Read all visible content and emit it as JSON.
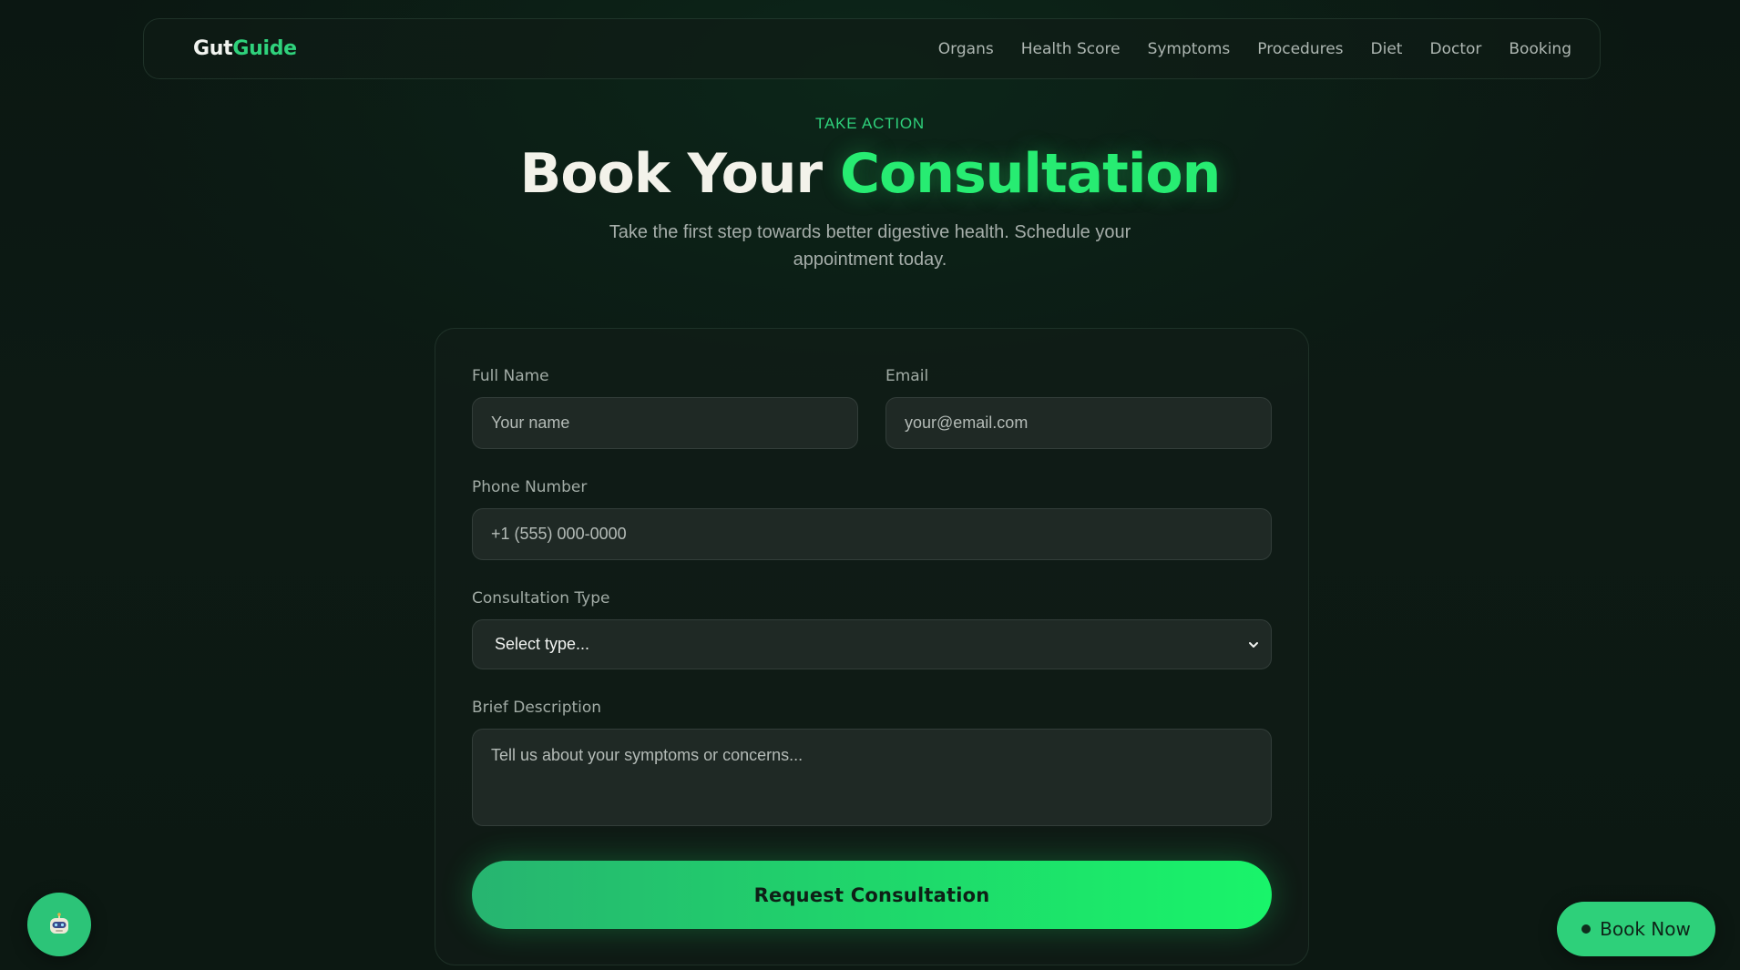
{
  "brand": {
    "name_part1": "Gut",
    "name_part2": "Guide"
  },
  "nav": {
    "items": [
      "Organs",
      "Health Score",
      "Symptoms",
      "Procedures",
      "Diet",
      "Doctor",
      "Booking"
    ]
  },
  "hero": {
    "eyebrow": "TAKE ACTION",
    "title_part1": "Book Your ",
    "title_part2": "Consultation",
    "subtitle": "Take the first step towards better digestive health. Schedule your appointment today."
  },
  "form": {
    "full_name": {
      "label": "Full Name",
      "value": "",
      "placeholder": "Your name"
    },
    "email": {
      "label": "Email",
      "value": "",
      "placeholder": "your@email.com"
    },
    "phone": {
      "label": "Phone Number",
      "value": "",
      "placeholder": "+1 (555) 000-0000"
    },
    "consultation_type": {
      "label": "Consultation Type",
      "selected": "Select type..."
    },
    "description": {
      "label": "Brief Description",
      "value": "",
      "placeholder": "Tell us about your symptoms or concerns..."
    },
    "submit_label": "Request Consultation"
  },
  "floating": {
    "chat_icon": "robot-icon",
    "book_now_label": "Book Now"
  },
  "colors": {
    "accent": "#27ec72",
    "accent_dark": "#2fd27c",
    "background": "#0c1812",
    "input_background": "#1f2925"
  }
}
